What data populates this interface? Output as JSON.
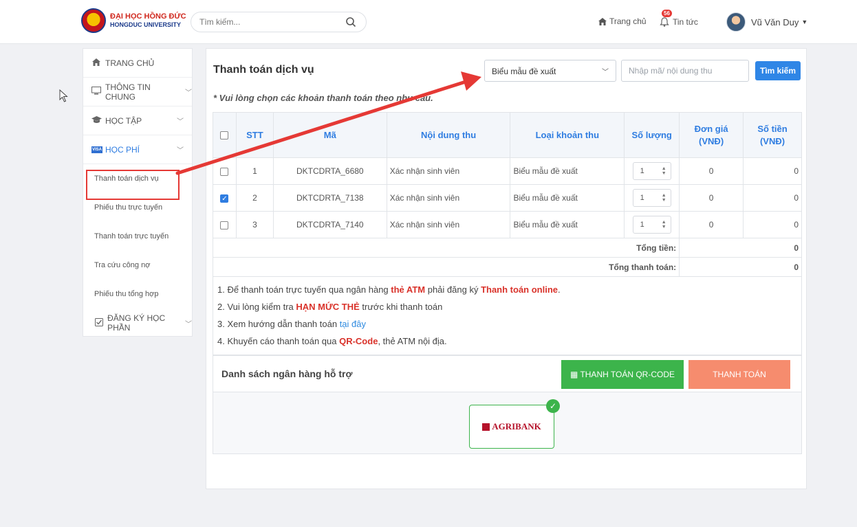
{
  "header": {
    "logo_line1": "ĐẠI HỌC HỒNG ĐỨC",
    "logo_line2": "HONGDUC UNIVERSITY",
    "search_placeholder": "Tìm kiếm...",
    "nav_home": "Trang chủ",
    "nav_news": "Tin tức",
    "news_badge": "56",
    "user_name": "Vũ Văn Duy"
  },
  "sidebar": {
    "items": [
      {
        "label": "TRANG CHỦ",
        "icon": "home-icon"
      },
      {
        "label": "THÔNG TIN CHUNG",
        "icon": "monitor-icon"
      },
      {
        "label": "HỌC TẬP",
        "icon": "graduation-cap-icon"
      },
      {
        "label": "HỌC PHÍ",
        "icon": "visa-card-icon"
      }
    ],
    "subitems": [
      "Thanh toán dịch vụ",
      "Phiếu thu trực tuyến",
      "Thanh toán trực tuyến",
      "Tra cứu công nợ",
      "Phiếu thu tổng hợp"
    ],
    "register_label": "ĐĂNG KÝ HỌC PHẦN"
  },
  "main": {
    "title": "Thanh toán dịch vụ",
    "select_value": "Biểu mẫu đề xuất",
    "code_placeholder": "Nhập mã/ nội dung thu",
    "search_button": "Tìm kiếm",
    "hint": "* Vui lòng chọn các khoản thanh toán theo nhu cầu."
  },
  "table": {
    "headers": {
      "stt": "STT",
      "ma": "Mã",
      "noi_dung": "Nội dung thu",
      "loai": "Loại khoản thu",
      "so_luong": "Số lượng",
      "don_gia_1": "Đơn giá",
      "don_gia_2": "(VNĐ)",
      "so_tien_1": "Số tiền",
      "so_tien_2": "(VNĐ)"
    },
    "rows": [
      {
        "stt": "1",
        "ma": "DKTCDRTA_6680",
        "noi_dung": "Xác nhận sinh viên",
        "loai": "Biểu mẫu đề xuất",
        "so_luong": "1",
        "don_gia": "0",
        "so_tien": "0",
        "checked": false
      },
      {
        "stt": "2",
        "ma": "DKTCDRTA_7138",
        "noi_dung": "Xác nhận sinh viên",
        "loai": "Biểu mẫu đề xuất",
        "so_luong": "1",
        "don_gia": "0",
        "so_tien": "0",
        "checked": true
      },
      {
        "stt": "3",
        "ma": "DKTCDRTA_7140",
        "noi_dung": "Xác nhận sinh viên",
        "loai": "Biểu mẫu đề xuất",
        "so_luong": "1",
        "don_gia": "0",
        "so_tien": "0",
        "checked": false
      }
    ],
    "total_label": "Tổng tiền:",
    "total_value": "0",
    "grand_total_label": "Tổng thanh toán:",
    "grand_total_value": "0"
  },
  "notes": {
    "n1_a": "1. Để thanh toán trực tuyến qua ngân hàng ",
    "n1_b": "thẻ ATM",
    "n1_c": " phải đăng ký ",
    "n1_d": "Thanh toán online",
    "n1_e": ".",
    "n2_a": "2. Vui lòng kiểm tra ",
    "n2_b": "HẠN MỨC THẺ",
    "n2_c": " trước khi thanh toán",
    "n3_a": "3. Xem hướng dẫn thanh toán ",
    "n3_b": "tại đây",
    "n4_a": "4. Khuyến cáo thanh toán qua ",
    "n4_b": "QR-Code",
    "n4_c": ", thẻ ATM nội địa."
  },
  "banks": {
    "title": "Danh sách ngân hàng hỗ trợ",
    "qr_button": "THANH TOÁN QR-CODE",
    "pay_button": "THANH TOÁN",
    "bank_name": "AGRIBANK"
  },
  "colors": {
    "accent": "#2f7de1",
    "qr_green": "#3cb44b",
    "pay_orange": "#f68c6e",
    "highlight_red": "#e53935"
  }
}
